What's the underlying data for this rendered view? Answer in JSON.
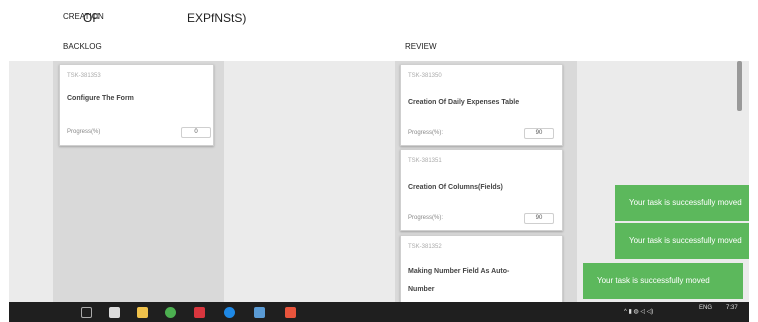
{
  "header": {
    "title_word1": "CREATION",
    "title_word2": "OF",
    "title_word3": "EXPfNStS)"
  },
  "columns": {
    "backlog_label": "BACKLOG",
    "review_label": "REVIEW"
  },
  "backlog_cards": [
    {
      "id": "TSK-381353",
      "title": "Configure The Form",
      "progress_label": "Progress(%)",
      "progress_value": "0"
    }
  ],
  "review_cards": [
    {
      "id": "TSK-381350",
      "title": "Creation Of Daily Expenses Table",
      "progress_label": "Progress(%):",
      "progress_value": "90"
    },
    {
      "id": "TSK-381351",
      "title": "Creation Of Columns(Fields)",
      "progress_label": "Progress(%):",
      "progress_value": "90"
    },
    {
      "id": "TSK-381352",
      "title_line1": "Making Number Field As Auto-",
      "title_line2": "Number"
    }
  ],
  "toasts": [
    {
      "text": "Your task is successfully moved"
    },
    {
      "text": "Your task is successfully moved"
    },
    {
      "text": "Your task is successfully moved"
    }
  ],
  "taskbar": {
    "tray_lang": "ENG",
    "tray_time": "7:37"
  },
  "colors": {
    "toast_green": "#5cb85c",
    "lane_gray": "#d9d9d9",
    "board_bg": "#ebebeb",
    "taskbar_bg": "#1f1f1f"
  }
}
